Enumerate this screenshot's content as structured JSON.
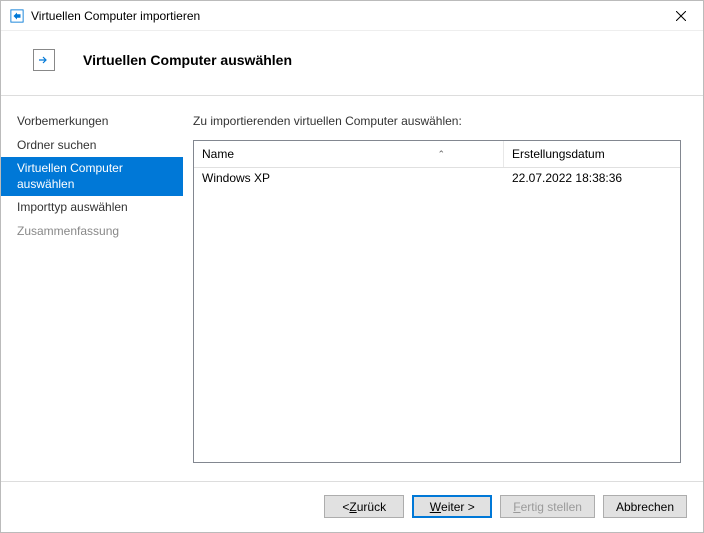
{
  "window": {
    "title": "Virtuellen Computer importieren"
  },
  "header": {
    "title": "Virtuellen Computer auswählen"
  },
  "sidebar": {
    "items": [
      {
        "label": "Vorbemerkungen",
        "state": "normal"
      },
      {
        "label": "Ordner suchen",
        "state": "normal"
      },
      {
        "label": "Virtuellen Computer auswählen",
        "state": "selected"
      },
      {
        "label": "Importtyp auswählen",
        "state": "normal"
      },
      {
        "label": "Zusammenfassung",
        "state": "disabled"
      }
    ]
  },
  "content": {
    "label": "Zu importierenden virtuellen Computer auswählen:",
    "columns": {
      "name": "Name",
      "date": "Erstellungsdatum"
    },
    "rows": [
      {
        "name": "Windows XP",
        "date": "22.07.2022 18:38:36"
      }
    ]
  },
  "buttons": {
    "back_prefix": "< ",
    "back_u": "Z",
    "back_rest": "urück",
    "next_u": "W",
    "next_rest": "eiter >",
    "finish_u": "F",
    "finish_rest": "ertig stellen",
    "cancel": "Abbrechen"
  }
}
